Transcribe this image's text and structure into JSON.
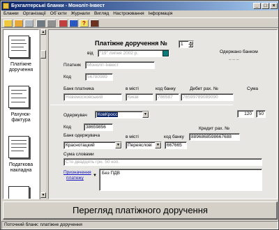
{
  "window": {
    "title": "Бухгалтерські бланки - Моноліт-Інвест",
    "minimize": "_",
    "maximize": "□",
    "close": "×"
  },
  "menu": [
    "Бланки",
    "Організації",
    "Об`єкти",
    "Журнали",
    "Вигляд",
    "Настроювання",
    "Інформація"
  ],
  "sidebar": {
    "items": [
      {
        "label_1": "Платіжне",
        "label_2": "доручення"
      },
      {
        "label_1": "Рахунок-",
        "label_2": "фактура"
      },
      {
        "label_1": "Податкова",
        "label_2": "накладна"
      }
    ]
  },
  "form": {
    "title": "Платіжне доручення №",
    "number": "1",
    "date_label": "від",
    "date_value": "\"19\" липня 2002 р.",
    "received_label": "Одержано банком",
    "received_value": "_ _ _",
    "payer_label": "Платник",
    "payer_value": "Моноліт-Інвест",
    "code_label": "Код",
    "payer_code": "56780989",
    "payer_bank_label": "Банк платника",
    "in_city_label": "в місті",
    "bank_code_label": "код банку",
    "debit_label": "Дебет рах. №",
    "sum_label": "Сума",
    "payer_bank": "Новомосковський",
    "payer_city": "Києві",
    "payer_bank_code": "786587",
    "debit_account": "76599789089090",
    "recipient_label": "Одержувач",
    "recipient_value": "КовКросс",
    "recipient_code_label": "Код",
    "recipient_code": "38659856",
    "sum_value": "120",
    "sum_kop": "50",
    "recipient_bank_label": "Банк одержувача",
    "recipient_in_city_label": "в місті",
    "recipient_bank_code_label": "код банку",
    "credit_label": "Кредит рах. №",
    "recipient_bank": "Краснотацкий",
    "recipient_city": "Переяслові",
    "recipient_bank_code": "667665",
    "credit_account": "8896868598667688",
    "sum_words_label": "Сума словами",
    "sum_words": "Сто двадцять грн. 50 коп.",
    "purpose_label_1": "Призначення",
    "purpose_label_2": "платежу",
    "purpose_value": "Без ПДВ"
  },
  "actions": {
    "view_button": "Перегляд платіжного доручення"
  },
  "status": {
    "text": "Поточний бланк: платіжне доручення"
  }
}
